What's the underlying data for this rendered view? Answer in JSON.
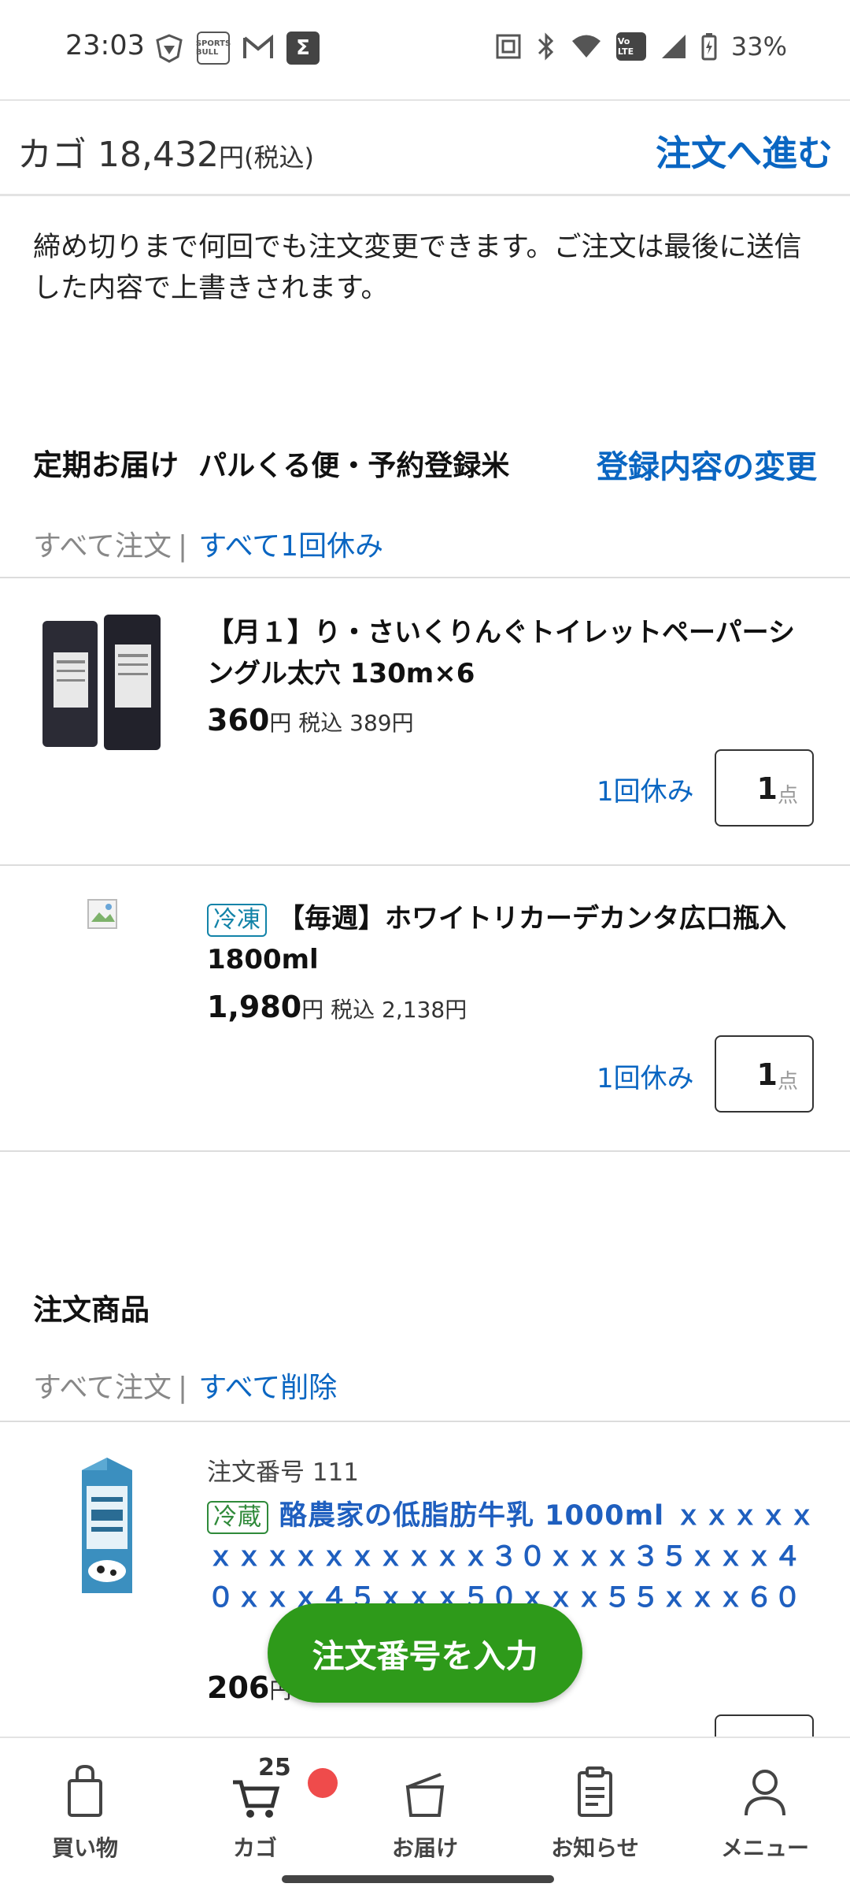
{
  "status_bar": {
    "time": "23:03",
    "left_icons": [
      "vpn-shield-icon",
      "sportsbull-icon",
      "gmail-icon",
      "sigma-icon"
    ],
    "sportsbull_label": "SPORTS BULL",
    "sigma_label": "Σ",
    "right_icons": [
      "nfc-icon",
      "bluetooth-icon",
      "wifi-icon",
      "volte-icon",
      "signal-icon",
      "battery-charging-icon"
    ],
    "volte_label": "Vo LTE",
    "battery": "33%"
  },
  "cart_header": {
    "label": "カゴ",
    "amount": "18,432",
    "currency": "円",
    "tax_note": "(税込)",
    "proceed_label": "注文へ進む"
  },
  "notice": "締め切りまで何回でも注文変更できます。ご注文は最後に送信した内容で上書きされます。",
  "regular_delivery": {
    "title": "定期お届け",
    "subtitle": "パルくる便・予約登録米",
    "change_link": "登録内容の変更",
    "action_all_order": "すべて注文",
    "separator": "|",
    "action_skip_all": "すべて1回休み",
    "items": [
      {
        "title": "【月１】り・さいくりんぐトイレットペーパーシングル太穴 130m×6",
        "price": "360",
        "yen": "円",
        "tax_label": "税込",
        "tax_price": "389円",
        "skip_label": "1回休み",
        "qty": "1",
        "unit": "点"
      },
      {
        "badge": "冷凍",
        "title": "【毎週】ホワイトリカーデカンタ広口瓶入 1800ml",
        "price": "1,980",
        "yen": "円",
        "tax_label": "税込",
        "tax_price": "2,138円",
        "skip_label": "1回休み",
        "qty": "1",
        "unit": "点"
      }
    ]
  },
  "order_items": {
    "title": "注文商品",
    "action_all_order": "すべて注文",
    "separator": "|",
    "action_delete_all": "すべて削除",
    "item": {
      "order_number_label": "注文番号 111",
      "badge": "冷蔵",
      "title": "酪農家の低脂肪牛乳 1000ml ｘｘｘｘｘｘｘｘｘｘｘｘｘｘｘ３０ｘｘｘ３５ｘｘｘ４０ｘｘｘ４５ｘｘｘ５０ｘｘｘ５５ｘｘｘ６０",
      "price": "206",
      "yen": "円"
    }
  },
  "fab_label": "注文番号を入力",
  "bottom_nav": {
    "items": [
      {
        "label": "買い物",
        "icon": "shopping-bag-icon"
      },
      {
        "label": "カゴ",
        "icon": "cart-icon"
      },
      {
        "label": "お届け",
        "icon": "delivery-box-icon"
      },
      {
        "label": "お知らせ",
        "icon": "notice-clipboard-icon"
      },
      {
        "label": "メニュー",
        "icon": "person-icon"
      }
    ],
    "cart_count": "25"
  },
  "colors": {
    "accent_blue": "#0a66c2",
    "fab_green": "#2e9a1a",
    "notification_red": "#ef4b4b",
    "frozen_badge": "#1283a8",
    "chilled_badge": "#2f8a3a"
  }
}
